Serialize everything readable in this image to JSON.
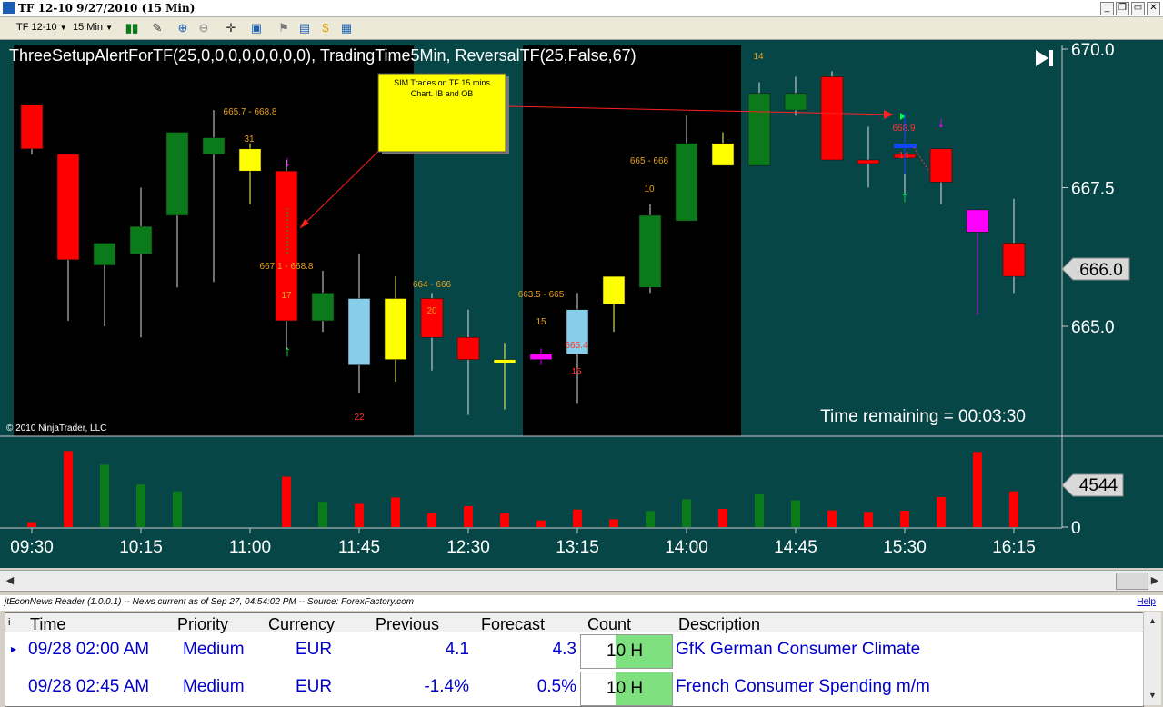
{
  "window": {
    "title": "TF 12-10  9/27/2010 (15 Min)",
    "minimize_label": "_",
    "restore_label": "❐",
    "maximize_label": "▭",
    "close_label": "✕"
  },
  "toolbar": {
    "instrument": "TF 12-10",
    "interval": "15 Min",
    "icons": [
      "bar-type-icon",
      "draw-pencil-icon",
      "zoom-in-icon",
      "zoom-out-icon",
      "crosshair-icon",
      "properties-icon",
      "attach-icon",
      "chart-style-icon",
      "dollar-icon",
      "data-box-icon"
    ]
  },
  "chart": {
    "indicator_label": "ThreeSetupAlertForTF(25,0,0,0,0,0,0,0,0), TradingTime5Min, ReversalTF(25,False,67)",
    "copyright": "© 2010 NinjaTrader, LLC",
    "time_remaining": "Time remaining = 00:03:30",
    "annotation_text": [
      "SIM Trades on TF 15 mins",
      "Chart. IB and OB"
    ],
    "last_price_label": "666.0",
    "last_volume_label": "4544",
    "colors": {
      "background": "#074647",
      "session": "#000000",
      "up": "#0a7a1a",
      "down": "#ff0000",
      "yellow": "#ffff00",
      "lightblue": "#87ceeb",
      "magenta": "#ff00ff",
      "text": "#ffffff"
    }
  },
  "chart_data": {
    "type": "candlestick",
    "price_axis": {
      "ticks": [
        665.0,
        667.5,
        670.0
      ],
      "labels": [
        "665.0",
        "667.5",
        "670.0"
      ],
      "ylim": [
        663.0,
        670.2
      ]
    },
    "volume_axis": {
      "ticks": [
        0
      ],
      "labels": [
        "0"
      ],
      "ylim": [
        0,
        5500
      ]
    },
    "time_labels": [
      "09:30",
      "10:15",
      "11:00",
      "11:45",
      "12:30",
      "13:15",
      "14:00",
      "14:45",
      "15:30",
      "16:15"
    ],
    "bars": [
      {
        "o": 669.0,
        "h": 669.0,
        "l": 668.1,
        "c": 668.2,
        "color": "down",
        "v": 300
      },
      {
        "o": 668.1,
        "h": 668.1,
        "l": 665.1,
        "c": 666.2,
        "color": "down",
        "v": 4600
      },
      {
        "o": 666.1,
        "h": 666.3,
        "l": 665.0,
        "c": 666.5,
        "color": "up",
        "v": 3780
      },
      {
        "o": 666.3,
        "h": 667.5,
        "l": 664.8,
        "c": 666.8,
        "color": "up",
        "v": 2580
      },
      {
        "o": 667.0,
        "h": 668.2,
        "l": 665.7,
        "c": 668.5,
        "color": "up",
        "v": 2160
      },
      {
        "o": 668.1,
        "h": 668.9,
        "l": 665.8,
        "c": 668.4,
        "color": "up",
        "v": 0
      },
      {
        "o": 668.2,
        "h": 668.3,
        "l": 667.2,
        "c": 667.8,
        "color": "yellow",
        "v": 0
      },
      {
        "o": 667.8,
        "h": 668.0,
        "l": 664.6,
        "c": 665.1,
        "color": "down",
        "v": 3050
      },
      {
        "o": 665.6,
        "h": 666.0,
        "l": 664.9,
        "c": 665.1,
        "color": "up",
        "v": 1530
      },
      {
        "o": 665.5,
        "h": 666.3,
        "l": 663.8,
        "c": 664.3,
        "color": "lightblue",
        "v": 1400
      },
      {
        "o": 665.5,
        "h": 665.9,
        "l": 664.0,
        "c": 664.4,
        "color": "yellow",
        "v": 1790
      },
      {
        "o": 665.5,
        "h": 665.6,
        "l": 664.2,
        "c": 664.8,
        "color": "down",
        "v": 840
      },
      {
        "o": 664.8,
        "h": 665.3,
        "l": 663.4,
        "c": 664.4,
        "color": "down",
        "v": 1260
      },
      {
        "o": 664.4,
        "h": 664.7,
        "l": 663.5,
        "c": 664.4,
        "color": "yellow",
        "v": 830
      },
      {
        "o": 664.5,
        "h": 664.6,
        "l": 664.3,
        "c": 664.4,
        "color": "magenta",
        "v": 400
      },
      {
        "o": 664.5,
        "h": 665.6,
        "l": 663.6,
        "c": 665.3,
        "color": "lightblue",
        "v": 1060
      },
      {
        "o": 665.4,
        "h": 665.6,
        "l": 664.9,
        "c": 665.9,
        "color": "yellow",
        "v": 470
      },
      {
        "o": 665.7,
        "h": 667.2,
        "l": 665.6,
        "c": 667.0,
        "color": "up",
        "v": 980
      },
      {
        "o": 666.9,
        "h": 668.8,
        "l": 666.9,
        "c": 668.3,
        "color": "up",
        "v": 1690
      },
      {
        "o": 668.3,
        "h": 668.5,
        "l": 667.9,
        "c": 667.9,
        "color": "yellow",
        "v": 1100
      },
      {
        "o": 669.2,
        "h": 669.4,
        "l": 667.9,
        "c": 667.9,
        "color": "up",
        "v": 1980
      },
      {
        "o": 669.2,
        "h": 669.5,
        "l": 668.8,
        "c": 668.9,
        "color": "up",
        "v": 1620
      },
      {
        "o": 669.5,
        "h": 669.6,
        "l": 668.0,
        "c": 668.0,
        "color": "down",
        "v": 1010
      },
      {
        "o": 668.0,
        "h": 668.6,
        "l": 667.5,
        "c": 668.0,
        "color": "down",
        "v": 920
      },
      {
        "o": 668.1,
        "h": 668.4,
        "l": 667.4,
        "c": 668.1,
        "color": "down",
        "v": 990
      },
      {
        "o": 668.2,
        "h": 668.2,
        "l": 667.2,
        "c": 667.6,
        "color": "down",
        "v": 1820
      },
      {
        "o": 667.1,
        "h": 667.1,
        "l": 665.2,
        "c": 666.7,
        "color": "magenta",
        "v": 4544
      },
      {
        "o": 666.5,
        "h": 667.3,
        "l": 665.6,
        "c": 665.9,
        "color": "down",
        "v": 2160
      }
    ],
    "labels": [
      {
        "text": "665.7 - 668.8",
        "color": "#e8a020"
      },
      {
        "text": "31",
        "color": "#e8a020"
      },
      {
        "text": "667.1 - 668.8",
        "color": "#e8a020"
      },
      {
        "text": "17",
        "color": "#e8a020"
      },
      {
        "text": "22",
        "color": "#ff3030"
      },
      {
        "text": "664 - 666",
        "color": "#e8a020"
      },
      {
        "text": "20",
        "color": "#e8a020"
      },
      {
        "text": "663.5 - 665",
        "color": "#e8a020"
      },
      {
        "text": "15",
        "color": "#e8a020"
      },
      {
        "text": "665.4",
        "color": "#ff3030"
      },
      {
        "text": "15",
        "color": "#ff3030"
      },
      {
        "text": "665 - 666",
        "color": "#e8a020"
      },
      {
        "text": "10",
        "color": "#e8a020"
      },
      {
        "text": "14",
        "color": "#e8a020"
      },
      {
        "text": "668.9",
        "color": "#ff3030"
      },
      {
        "text": "14",
        "color": "#ff3030"
      }
    ]
  },
  "news": {
    "reader_label": "jtEconNews Reader (1.0.0.1)  --  News current as of Sep 27, 04:54:02 PM  --  Source: ForexFactory.com",
    "help_label": "Help",
    "columns": [
      "Time",
      "Priority",
      "Currency",
      "Previous",
      "Forecast",
      "Count",
      "Description"
    ],
    "header_marker": "i",
    "rows": [
      {
        "marker": "▸",
        "time": "09/28 02:00 AM",
        "priority": "Medium",
        "currency": "EUR",
        "previous": "4.1",
        "forecast": "4.3",
        "count": "10 H",
        "description": "GfK German Consumer Climate"
      },
      {
        "marker": "",
        "time": "09/28 02:45 AM",
        "priority": "Medium",
        "currency": "EUR",
        "previous": "-1.4%",
        "forecast": "0.5%",
        "count": "10 H",
        "description": "French Consumer Spending m/m"
      }
    ]
  }
}
